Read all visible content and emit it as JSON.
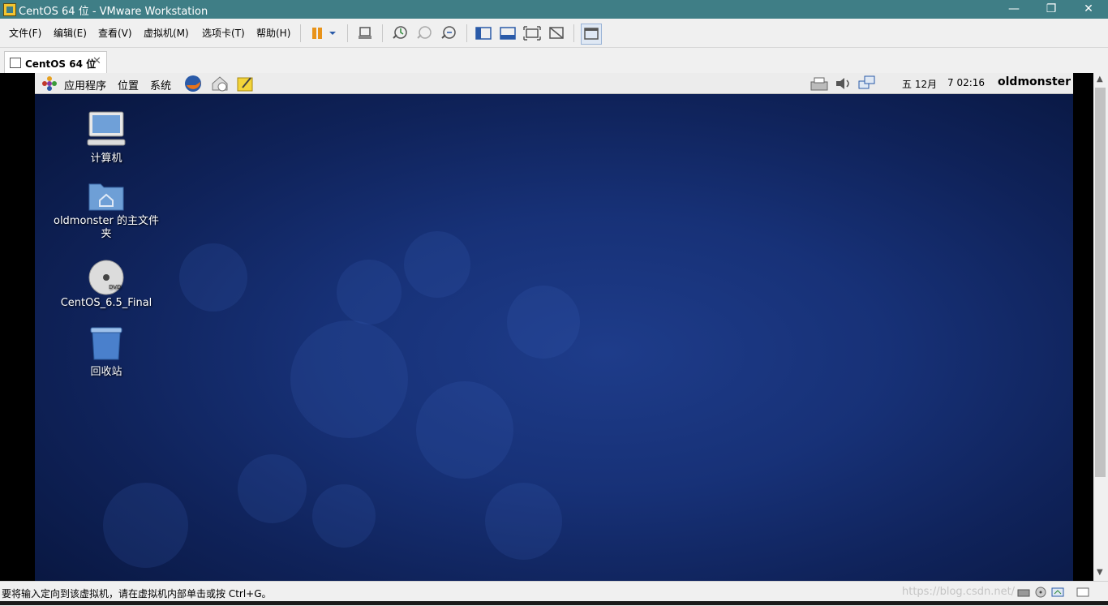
{
  "window": {
    "title": "CentOS 64 位 - VMware Workstation",
    "controls": {
      "minimize": "—",
      "restore": "❐",
      "close": "✕"
    }
  },
  "menu": {
    "items": [
      "文件(F)",
      "编辑(E)",
      "查看(V)",
      "虚拟机(M)",
      "选项卡(T)",
      "帮助(H)"
    ]
  },
  "toolbar": {
    "icons": [
      "pause-icon",
      "dropdown-icon",
      "send-ctrl-alt-del-icon",
      "snapshot-icon",
      "revert-snapshot-icon",
      "snapshot-manager-icon",
      "show-library-icon",
      "thumbnail-bar-icon",
      "full-screen-icon",
      "unity-icon",
      "console-view-icon"
    ]
  },
  "tab": {
    "label": "CentOS 64 位",
    "close": "✕"
  },
  "guest": {
    "panel": {
      "apps": "应用程序",
      "places": "位置",
      "system": "系统",
      "date": "五 12月",
      "time": "7 02:16",
      "user": "oldmonster"
    },
    "desktop_icons": [
      {
        "label": "计算机",
        "icon": "computer-icon"
      },
      {
        "label": "oldmonster 的主文件夹",
        "icon": "home-folder-icon"
      },
      {
        "label": "CentOS_6.5_Final",
        "icon": "dvd-icon"
      },
      {
        "label": "回收站",
        "icon": "trash-icon"
      }
    ]
  },
  "status": {
    "message": "要将输入定向到该虚拟机，请在虚拟机内部单击或按 Ctrl+G。",
    "watermark": "https://blog.csdn.net/"
  },
  "colors": {
    "titlebar": "#3f7e86",
    "desktop": "#173177",
    "panel": "#ececec"
  }
}
